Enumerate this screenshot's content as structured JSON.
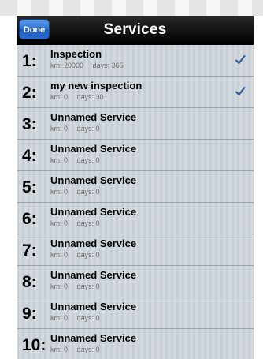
{
  "navbar": {
    "title": "Services",
    "done_label": "Done"
  },
  "list": {
    "km_label": "km:",
    "days_label": "days:",
    "items": [
      {
        "number": "1:",
        "name": "Inspection",
        "km": "20000",
        "days": "365",
        "checked": true
      },
      {
        "number": "2:",
        "name": "my new inspection",
        "km": "0",
        "days": "30",
        "checked": true
      },
      {
        "number": "3:",
        "name": "Unnamed Service",
        "km": "0",
        "days": "0",
        "checked": false
      },
      {
        "number": "4:",
        "name": "Unnamed Service",
        "km": "0",
        "days": "0",
        "checked": false
      },
      {
        "number": "5:",
        "name": "Unnamed Service",
        "km": "0",
        "days": "0",
        "checked": false
      },
      {
        "number": "6:",
        "name": "Unnamed Service",
        "km": "0",
        "days": "0",
        "checked": false
      },
      {
        "number": "7:",
        "name": "Unnamed Service",
        "km": "0",
        "days": "0",
        "checked": false
      },
      {
        "number": "8:",
        "name": "Unnamed Service",
        "km": "0",
        "days": "0",
        "checked": false
      },
      {
        "number": "9:",
        "name": "Unnamed Service",
        "km": "0",
        "days": "0",
        "checked": false
      },
      {
        "number": "10:",
        "name": "Unnamed Service",
        "km": "0",
        "days": "0",
        "checked": false
      }
    ]
  },
  "colors": {
    "checkmark": "#2f5f9a",
    "done_button": "#2f74d8",
    "navbar": "#000000"
  },
  "icons": {
    "check": "check-icon"
  }
}
